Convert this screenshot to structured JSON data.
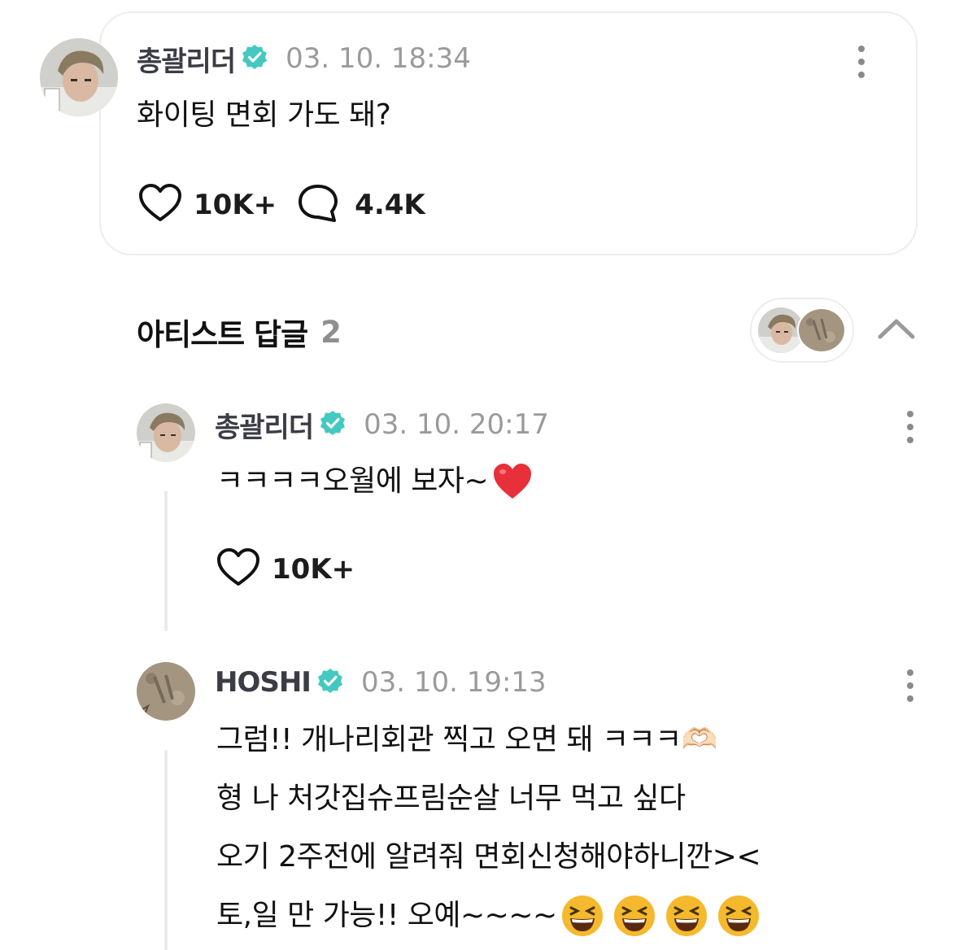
{
  "post": {
    "author": "총괄리더",
    "timestamp": "03. 10. 18:34",
    "text": "화이팅 면회 가도 돼?",
    "likes": "10K+",
    "comments": "4.4K"
  },
  "artist_replies": {
    "title": "아티스트 답글",
    "count": "2"
  },
  "replies": [
    {
      "author": "총괄리더",
      "timestamp": "03. 10. 20:17",
      "text": "ㅋㅋㅋㅋ오월에 보자~",
      "likes": "10K+"
    },
    {
      "author": "HOSHI",
      "timestamp": "03. 10. 19:13",
      "lines": [
        "그럼!! 개나리회관 찍고 오면 돼 ㅋㅋㅋ🫶🏻",
        "형 나 처갓집슈프림순살 너무 먹고 싶다",
        "오기 2주전에 알려줘 면회신청해야하니깐><",
        "토,일 만 가능!! 오예~~~~"
      ]
    }
  ],
  "colors": {
    "verified": "#45c8c0",
    "heart_emoji": "#e8303a",
    "emoji_face": "#f5b92d"
  }
}
